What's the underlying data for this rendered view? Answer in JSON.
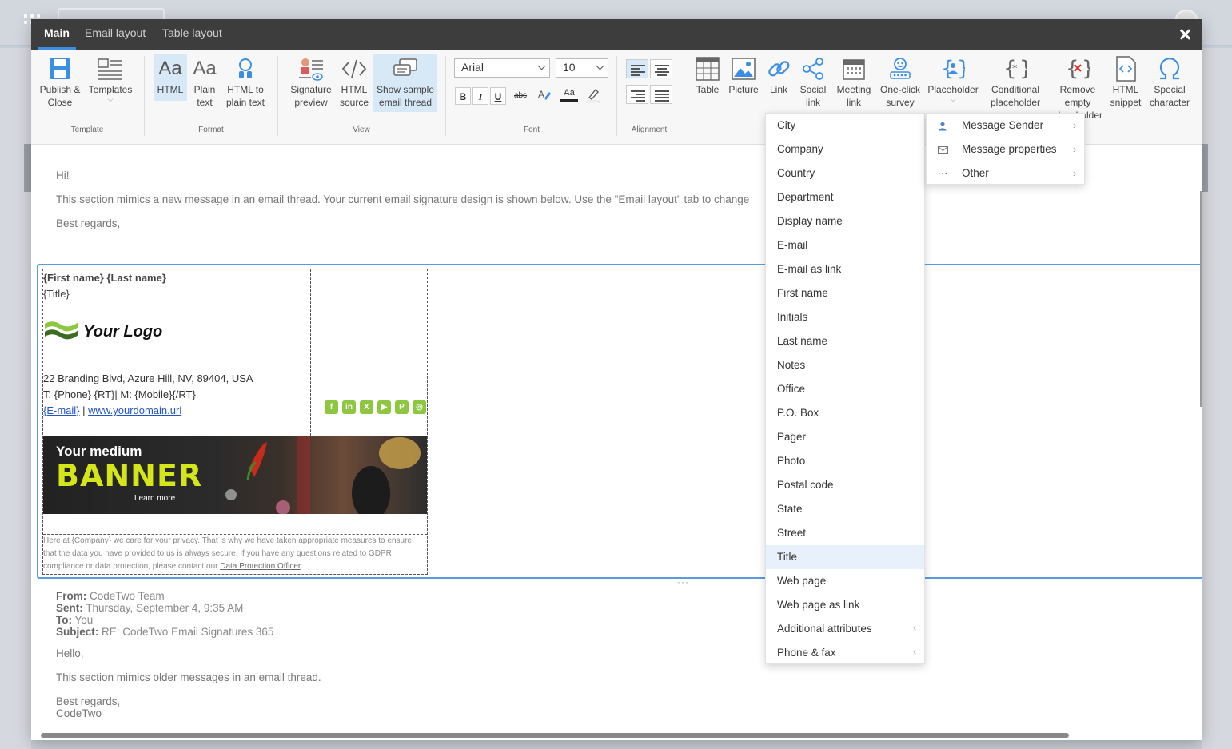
{
  "tabs": [
    {
      "label": "Main",
      "active": true
    },
    {
      "label": "Email layout",
      "active": false
    },
    {
      "label": "Table layout",
      "active": false
    }
  ],
  "ribbon": {
    "template": {
      "group_label": "Template",
      "publish_close": "Publish &\nClose",
      "templates": "Templates"
    },
    "format": {
      "group_label": "Format",
      "html": "HTML",
      "plain_text": "Plain\ntext",
      "html_to_plain": "HTML to\nplain text",
      "glyph": "Aa"
    },
    "view": {
      "group_label": "View",
      "signature_preview": "Signature\npreview",
      "html_source": "HTML\nsource",
      "show_sample": "Show sample\nemail thread"
    },
    "font": {
      "group_label": "Font",
      "font_name": "Arial",
      "font_size": "10",
      "bold": "B",
      "italic": "I",
      "underline": "U",
      "strike": "abc",
      "font_color": "Aa"
    },
    "alignment": {
      "group_label": "Alignment"
    },
    "insert": {
      "table": "Table",
      "picture": "Picture",
      "link": "Link",
      "social_link": "Social\nlink",
      "meeting_link": "Meeting\nlink",
      "one_click_survey": "One-click\nsurvey",
      "placeholder": "Placeholder",
      "conditional_placeholder": "Conditional\nplaceholder",
      "remove_empty": "Remove\nempty\nplaceholder",
      "html_snippet": "HTML\nsnippet",
      "special_character": "Special\ncharacter"
    }
  },
  "email": {
    "greeting": "Hi!",
    "body": "This section mimics a new message in an email thread. Your current email signature design is shown below. Use the \"Email layout\" tab to change",
    "regards": "Best regards,"
  },
  "signature": {
    "name_line": "{First name} {Last name}",
    "title": "{Title}",
    "logo_text": "Your Logo",
    "address": "22 Branding Blvd, Azure Hill, NV, 89404, USA",
    "phones": "T: {Phone} {RT}| M: {Mobile}{/RT}",
    "email_link": "{E-mail}",
    "separator": "|",
    "website": "www.yourdomain.url",
    "social": [
      "f",
      "in",
      "X",
      "▶",
      "P",
      "◎"
    ],
    "banner": {
      "line1": "Your medium",
      "line2": "BANNER",
      "cta": "Learn more"
    },
    "privacy": "Here at {Company} we care for your privacy. That is why we have taken appropriate measures to ensure that the data you have provided to us is always secure. If you have any questions related to GDPR compliance or data protection, please contact our",
    "privacy_link": "Data Protection Officer",
    "privacy_end": "."
  },
  "older_message": {
    "from_label": "From:",
    "from": "CodeTwo Team",
    "sent_label": "Sent:",
    "sent": "Thursday, September 4, 9:35 AM",
    "to_label": "To:",
    "to": "You",
    "subject_label": "Subject:",
    "subject": "RE: CodeTwo Email Signatures 365",
    "hello": "Hello,",
    "body": "This section mimics older messages in an email thread.",
    "regards": "Best regards,",
    "signoff": "CodeTwo"
  },
  "placeholder_menu": {
    "items": [
      "City",
      "Company",
      "Country",
      "Department",
      "Display name",
      "E-mail",
      "E-mail as link",
      "First name",
      "Initials",
      "Last name",
      "Notes",
      "Office",
      "P.O. Box",
      "Pager",
      "Photo",
      "Postal code",
      "State",
      "Street",
      "Title",
      "Web page",
      "Web page as link",
      "Additional attributes",
      "Phone & fax"
    ],
    "highlighted": "Title"
  },
  "placeholder_submenu": {
    "items": [
      {
        "label": "Message Sender",
        "icon": "person-icon"
      },
      {
        "label": "Message properties",
        "icon": "envelope-icon"
      },
      {
        "label": "Other",
        "icon": "more-icon"
      }
    ]
  },
  "colors": {
    "accent": "#3b8ee3",
    "tabbar": "#3d3d3d",
    "selected": "#d7e8f7",
    "social": "#8dc63f",
    "banner_text": "#d4e61a"
  }
}
